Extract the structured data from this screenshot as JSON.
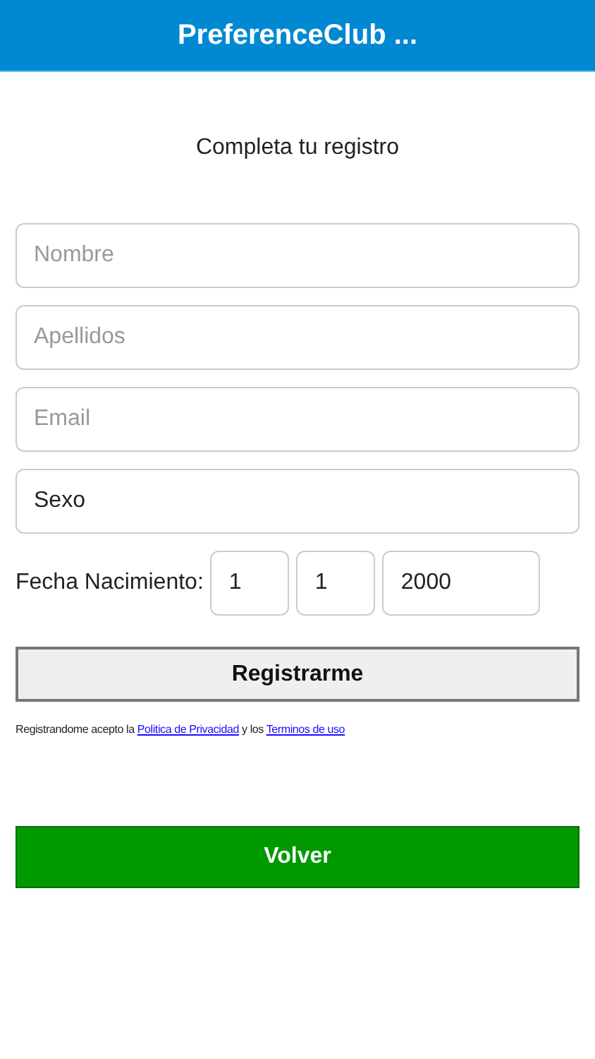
{
  "header": {
    "title": "PreferenceClub ..."
  },
  "heading": "Completa tu registro",
  "fields": [
    {
      "placeholder": "Nombre"
    },
    {
      "placeholder": "Apellidos"
    },
    {
      "placeholder": "Email"
    },
    {
      "value": "Sexo"
    }
  ],
  "birth_date": {
    "label": "Fecha Nacimiento:",
    "day": "1",
    "month": "1",
    "year": "2000"
  },
  "register_button": "Registrarme",
  "legal": {
    "before": "Registrandome acepto la",
    "privacy_link": "Politica de Privacidad",
    "middle": "y los",
    "terms_link": "Terminos de uso"
  },
  "back_button": "Volver"
}
